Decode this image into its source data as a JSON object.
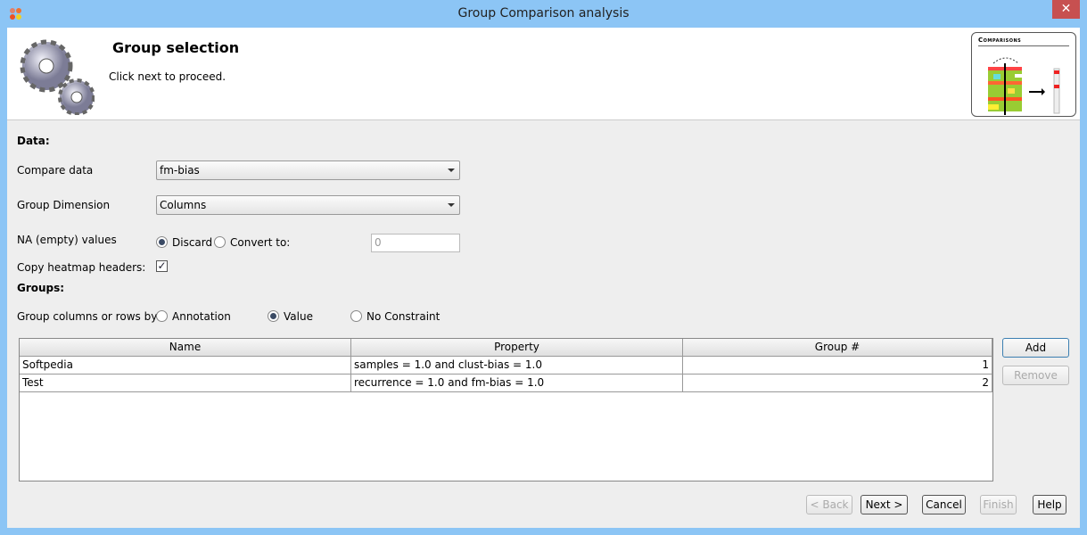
{
  "window": {
    "title": "Group Comparison analysis",
    "close": "✕"
  },
  "header": {
    "title": "Group selection",
    "subtitle": "Click next to proceed.",
    "thumbnail_title": "Comparisons"
  },
  "form": {
    "data_heading": "Data:",
    "compare_label": "Compare data",
    "compare_value": "fm-bias",
    "dimension_label": "Group Dimension",
    "dimension_value": "Columns",
    "na_label": "NA (empty) values",
    "na_discard": "Discard",
    "na_convert": "Convert to:",
    "na_convert_value": "0",
    "na_selected": "Discard",
    "copy_label": "Copy heatmap headers:",
    "copy_checked": true,
    "groups_heading": "Groups:",
    "groupby_label": "Group columns or rows by:",
    "groupby_options": [
      "Annotation",
      "Value",
      "No Constraint"
    ],
    "groupby_selected": "Value"
  },
  "table": {
    "columns": [
      "Name",
      "Property",
      "Group #"
    ],
    "rows": [
      [
        "Softpedia",
        "samples = 1.0 and clust-bias = 1.0",
        "1"
      ],
      [
        "Test",
        "recurrence = 1.0 and fm-bias = 1.0",
        "2"
      ]
    ]
  },
  "side_buttons": {
    "add": "Add",
    "remove": "Remove"
  },
  "footer": {
    "back": "< Back",
    "next": "Next >",
    "cancel": "Cancel",
    "finish": "Finish",
    "help": "Help"
  }
}
